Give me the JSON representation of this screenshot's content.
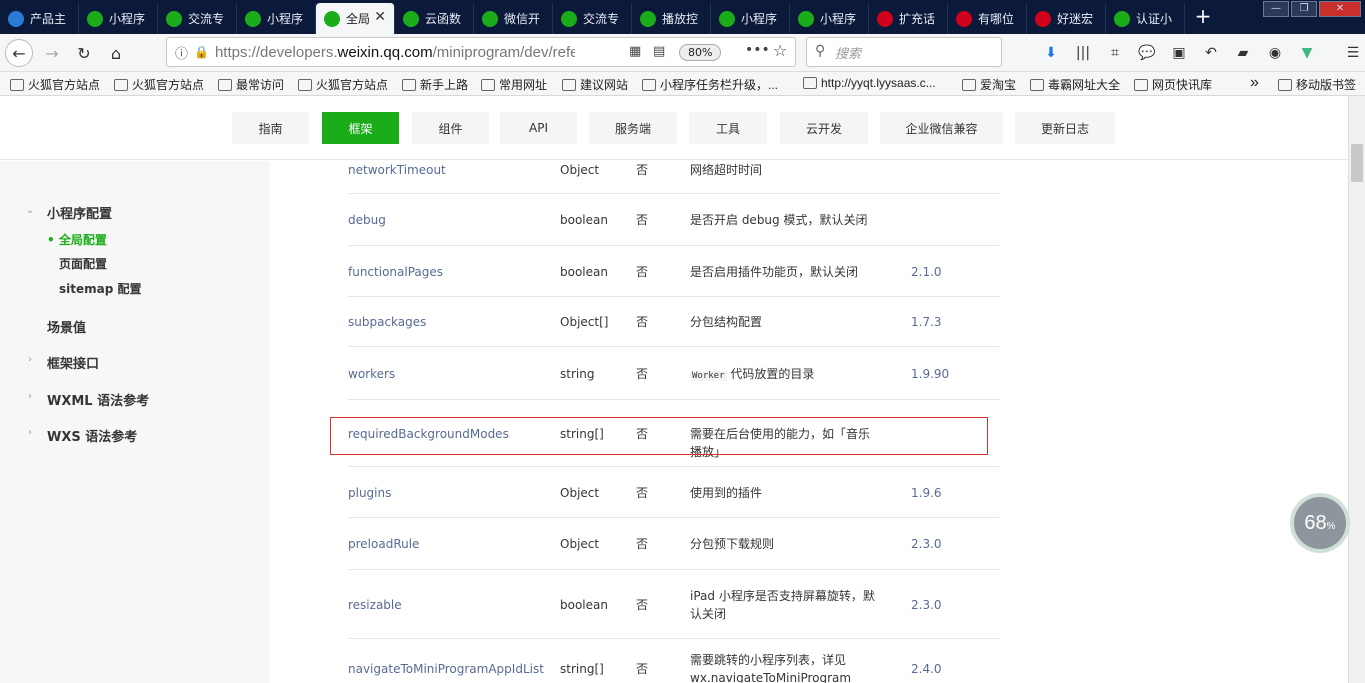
{
  "tabs": [
    {
      "label": "产品主",
      "color": "#2b7bd6"
    },
    {
      "label": "小程序",
      "color": "#1aad19"
    },
    {
      "label": "交流专",
      "color": "#1aad19"
    },
    {
      "label": "小程序",
      "color": "#1aad19"
    },
    {
      "label": "全局",
      "color": "#1aad19",
      "active": true
    },
    {
      "label": "云函数",
      "color": "#1aad19"
    },
    {
      "label": "微信开",
      "color": "#1aad19"
    },
    {
      "label": "交流专",
      "color": "#1aad19"
    },
    {
      "label": "播放控",
      "color": "#1aad19"
    },
    {
      "label": "小程序",
      "color": "#1aad19"
    },
    {
      "label": "小程序",
      "color": "#1aad19"
    },
    {
      "label": "扩充话",
      "color": "#d0021b"
    },
    {
      "label": "有哪位",
      "color": "#d0021b"
    },
    {
      "label": "好迷宏",
      "color": "#d0021b"
    },
    {
      "label": "认证小",
      "color": "#1aad19"
    }
  ],
  "url": {
    "prefix": "https://developers.",
    "domain": "weixin.qq.com",
    "path": "/miniprogram/dev/refere"
  },
  "zoom": "80%",
  "search_placeholder": "搜索",
  "bookmarks": [
    "火狐官方站点",
    "火狐官方站点",
    "最常访问",
    "火狐官方站点",
    "新手上路",
    "常用网址",
    "建议网站",
    "小程序任务栏升级，...",
    "http://yyqt.lyysaas.c...",
    "爱淘宝",
    "毒霸网址大全",
    "网页快讯库",
    "移动版书签"
  ],
  "topnav": [
    "指南",
    "框架",
    "组件",
    "API",
    "服务端",
    "工具",
    "云开发",
    "企业微信兼容",
    "更新日志"
  ],
  "sidebar": {
    "config": "小程序配置",
    "global": "全局配置",
    "page": "页面配置",
    "sitemap": "sitemap 配置",
    "scene": "场景值",
    "api": "框架接口",
    "wxml": "WXML 语法参考",
    "wxs": "WXS 语法参考"
  },
  "rows": [
    {
      "name": "networkTimeout",
      "type": "Object",
      "req": "否",
      "desc": "网络超时时间",
      "ver": ""
    },
    {
      "name": "debug",
      "type": "boolean",
      "req": "否",
      "desc": "是否开启 debug 模式，默认关闭",
      "ver": ""
    },
    {
      "name": "functionalPages",
      "type": "boolean",
      "req": "否",
      "desc": "是否启用插件功能页，默认关闭",
      "ver": "2.1.0"
    },
    {
      "name": "subpackages",
      "type": "Object[]",
      "req": "否",
      "desc": "分包结构配置",
      "ver": "1.7.3"
    },
    {
      "name": "workers",
      "type": "string",
      "req": "否",
      "desc": "代码放置的目录",
      "code": "Worker",
      "ver": "1.9.90"
    },
    {
      "name": "requiredBackgroundModes",
      "type": "string[]",
      "req": "否",
      "desc": "需要在后台使用的能力，如「音乐播放」",
      "ver": ""
    },
    {
      "name": "plugins",
      "type": "Object",
      "req": "否",
      "desc": "使用到的插件",
      "ver": "1.9.6"
    },
    {
      "name": "preloadRule",
      "type": "Object",
      "req": "否",
      "desc": "分包预下载规则",
      "ver": "2.3.0"
    },
    {
      "name": "resizable",
      "type": "boolean",
      "req": "否",
      "desc": "iPad 小程序是否支持屏幕旋转，默认关闭",
      "ver": "2.3.0"
    },
    {
      "name": "navigateToMiniProgramAppIdList",
      "type": "string[]",
      "req": "否",
      "desc": "需要跳转的小程序列表，详见 wx.navigateToMiniProgram",
      "ver": "2.4.0"
    }
  ],
  "gauge": {
    "value": "68",
    "unit": "%"
  }
}
